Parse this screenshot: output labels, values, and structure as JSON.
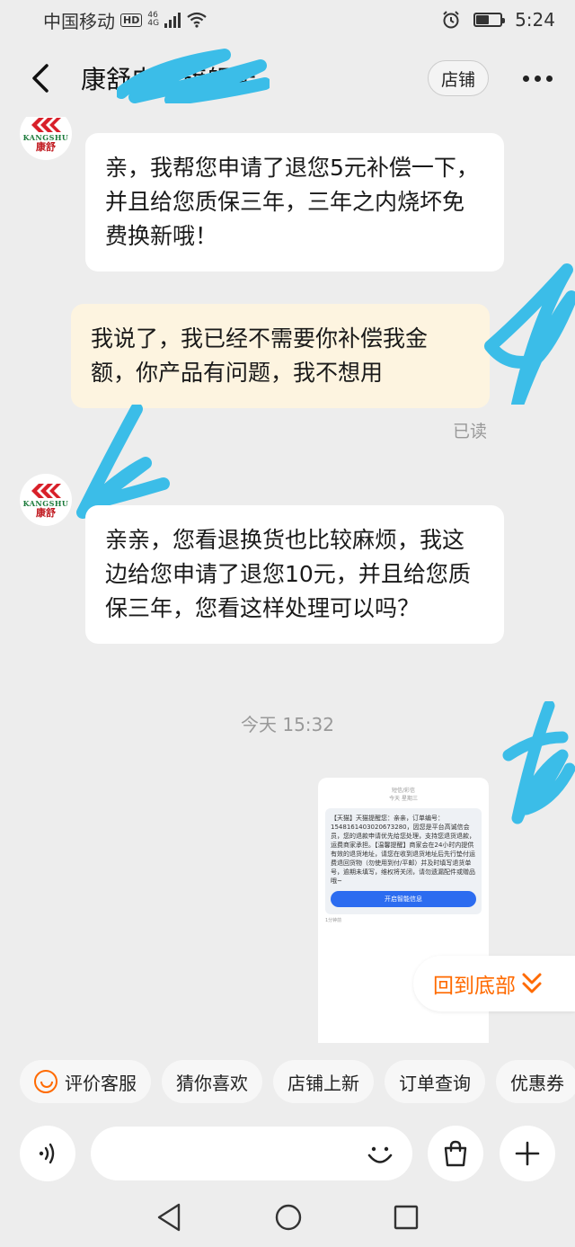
{
  "status": {
    "carrier": "中国移动",
    "hd": "HD",
    "network": "4G",
    "network_sub": "46",
    "time": "5:24",
    "battery_level": 0.55
  },
  "header": {
    "title": "康舒电器旗舰店",
    "shop_button": "店铺"
  },
  "messages": [
    {
      "from": "shop",
      "text": "亲，我帮您申请了退您5元补偿一下，并且给您质保三年，三年之内烧坏免费换新哦！"
    },
    {
      "from": "user",
      "text": "我说了，我已经不需要你补偿我金额，你产品有问题，我不想用",
      "status": "已读"
    },
    {
      "from": "shop",
      "text": "亲亲，您看退换货也比较麻烦，我这边给您申请了退您10元，并且给您质保三年，您看这样处理可以吗？"
    }
  ],
  "avatar_logo": {
    "en": "KANGSHU",
    "cn": "康舒"
  },
  "timestamp": "今天 15:32",
  "image_message": {
    "head_1": "短信/彩信",
    "head_2": "今天 星期三",
    "body": "【天猫】天猫提醒您：亲亲，订单编号：1548161403020673280，因您是平台高诚信会员，您的退款申请优先给您处理，支持您退货退款，运费商家承担。【温馨提醒】商家会在24小时内提供有效的退货地址，请您在收到退货地址后先行垫付运费退回货物（勿使用到付/平邮）并及时填写退货单号，逾期未填写，维权将关闭，请勿遗漏配件或赠品哦~",
    "button": "开启智能信息",
    "foot": "1分钟前"
  },
  "back_to_bottom": "回到底部",
  "chips": [
    "评价客服",
    "猜你喜欢",
    "店铺上新",
    "订单查询",
    "优惠券"
  ],
  "input": {
    "placeholder": ""
  },
  "colors": {
    "accent": "#ff6a00",
    "user_bubble": "#fdf4e0",
    "scribble": "#3bbde8"
  }
}
